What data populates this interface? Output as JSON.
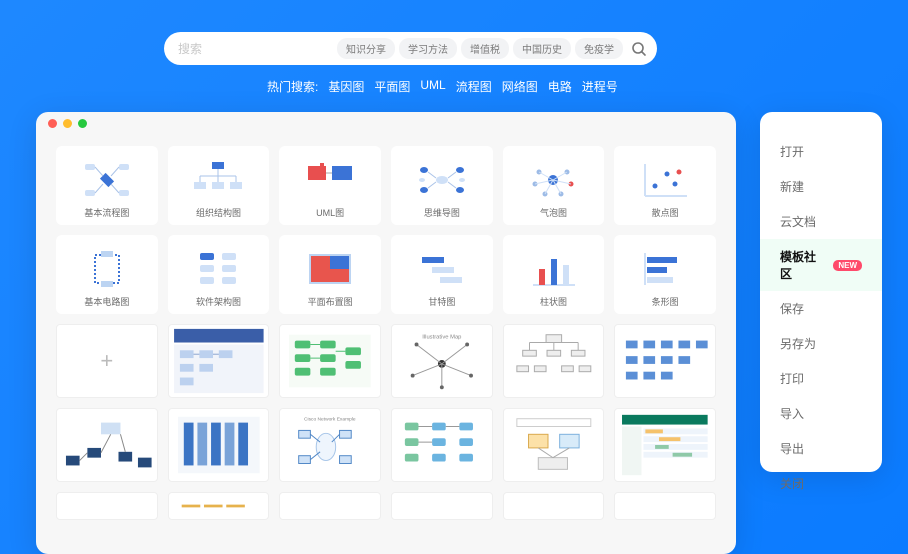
{
  "search": {
    "placeholder": "搜索",
    "tags": [
      "知识分享",
      "学习方法",
      "增值税",
      "中国历史",
      "免疫学"
    ]
  },
  "hot": {
    "label": "热门搜索:",
    "items": [
      "基因图",
      "平面图",
      "UML",
      "流程图",
      "网络图",
      "电路",
      "进程号"
    ]
  },
  "categories": [
    {
      "label": "基本流程图",
      "icon": "flowchart"
    },
    {
      "label": "组织结构图",
      "icon": "orgchart"
    },
    {
      "label": "UML图",
      "icon": "uml"
    },
    {
      "label": "思维导图",
      "icon": "mindmap"
    },
    {
      "label": "气泡图",
      "icon": "bubble"
    },
    {
      "label": "散点图",
      "icon": "scatter"
    },
    {
      "label": "基本电路图",
      "icon": "circuit"
    },
    {
      "label": "软件架构图",
      "icon": "architecture"
    },
    {
      "label": "平面布置图",
      "icon": "floorplan"
    },
    {
      "label": "甘特图",
      "icon": "gantt"
    },
    {
      "label": "柱状图",
      "icon": "barchart"
    },
    {
      "label": "条形图",
      "icon": "hbarchart"
    }
  ],
  "menu": {
    "items": [
      {
        "label": "打开",
        "active": false
      },
      {
        "label": "新建",
        "active": false
      },
      {
        "label": "云文档",
        "active": false
      },
      {
        "label": "模板社区",
        "active": true,
        "badge": "NEW"
      },
      {
        "label": "保存",
        "active": false
      },
      {
        "label": "另存为",
        "active": false
      },
      {
        "label": "打印",
        "active": false
      },
      {
        "label": "导入",
        "active": false
      },
      {
        "label": "导出",
        "active": false
      },
      {
        "label": "关闭",
        "active": false
      }
    ]
  }
}
